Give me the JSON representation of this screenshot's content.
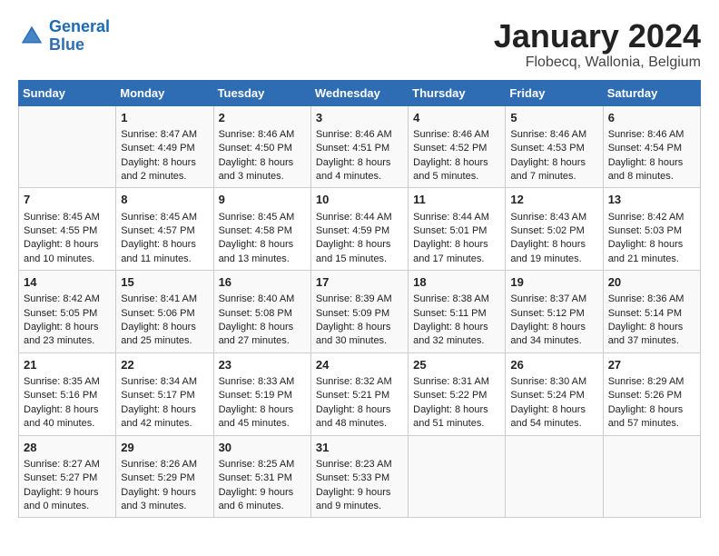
{
  "header": {
    "logo_line1": "General",
    "logo_line2": "Blue",
    "title": "January 2024",
    "subtitle": "Flobecq, Wallonia, Belgium"
  },
  "calendar": {
    "headers": [
      "Sunday",
      "Monday",
      "Tuesday",
      "Wednesday",
      "Thursday",
      "Friday",
      "Saturday"
    ],
    "rows": [
      [
        {
          "day": "",
          "sunrise": "",
          "sunset": "",
          "daylight": ""
        },
        {
          "day": "1",
          "sunrise": "Sunrise: 8:47 AM",
          "sunset": "Sunset: 4:49 PM",
          "daylight": "Daylight: 8 hours and 2 minutes."
        },
        {
          "day": "2",
          "sunrise": "Sunrise: 8:46 AM",
          "sunset": "Sunset: 4:50 PM",
          "daylight": "Daylight: 8 hours and 3 minutes."
        },
        {
          "day": "3",
          "sunrise": "Sunrise: 8:46 AM",
          "sunset": "Sunset: 4:51 PM",
          "daylight": "Daylight: 8 hours and 4 minutes."
        },
        {
          "day": "4",
          "sunrise": "Sunrise: 8:46 AM",
          "sunset": "Sunset: 4:52 PM",
          "daylight": "Daylight: 8 hours and 5 minutes."
        },
        {
          "day": "5",
          "sunrise": "Sunrise: 8:46 AM",
          "sunset": "Sunset: 4:53 PM",
          "daylight": "Daylight: 8 hours and 7 minutes."
        },
        {
          "day": "6",
          "sunrise": "Sunrise: 8:46 AM",
          "sunset": "Sunset: 4:54 PM",
          "daylight": "Daylight: 8 hours and 8 minutes."
        }
      ],
      [
        {
          "day": "7",
          "sunrise": "Sunrise: 8:45 AM",
          "sunset": "Sunset: 4:55 PM",
          "daylight": "Daylight: 8 hours and 10 minutes."
        },
        {
          "day": "8",
          "sunrise": "Sunrise: 8:45 AM",
          "sunset": "Sunset: 4:57 PM",
          "daylight": "Daylight: 8 hours and 11 minutes."
        },
        {
          "day": "9",
          "sunrise": "Sunrise: 8:45 AM",
          "sunset": "Sunset: 4:58 PM",
          "daylight": "Daylight: 8 hours and 13 minutes."
        },
        {
          "day": "10",
          "sunrise": "Sunrise: 8:44 AM",
          "sunset": "Sunset: 4:59 PM",
          "daylight": "Daylight: 8 hours and 15 minutes."
        },
        {
          "day": "11",
          "sunrise": "Sunrise: 8:44 AM",
          "sunset": "Sunset: 5:01 PM",
          "daylight": "Daylight: 8 hours and 17 minutes."
        },
        {
          "day": "12",
          "sunrise": "Sunrise: 8:43 AM",
          "sunset": "Sunset: 5:02 PM",
          "daylight": "Daylight: 8 hours and 19 minutes."
        },
        {
          "day": "13",
          "sunrise": "Sunrise: 8:42 AM",
          "sunset": "Sunset: 5:03 PM",
          "daylight": "Daylight: 8 hours and 21 minutes."
        }
      ],
      [
        {
          "day": "14",
          "sunrise": "Sunrise: 8:42 AM",
          "sunset": "Sunset: 5:05 PM",
          "daylight": "Daylight: 8 hours and 23 minutes."
        },
        {
          "day": "15",
          "sunrise": "Sunrise: 8:41 AM",
          "sunset": "Sunset: 5:06 PM",
          "daylight": "Daylight: 8 hours and 25 minutes."
        },
        {
          "day": "16",
          "sunrise": "Sunrise: 8:40 AM",
          "sunset": "Sunset: 5:08 PM",
          "daylight": "Daylight: 8 hours and 27 minutes."
        },
        {
          "day": "17",
          "sunrise": "Sunrise: 8:39 AM",
          "sunset": "Sunset: 5:09 PM",
          "daylight": "Daylight: 8 hours and 30 minutes."
        },
        {
          "day": "18",
          "sunrise": "Sunrise: 8:38 AM",
          "sunset": "Sunset: 5:11 PM",
          "daylight": "Daylight: 8 hours and 32 minutes."
        },
        {
          "day": "19",
          "sunrise": "Sunrise: 8:37 AM",
          "sunset": "Sunset: 5:12 PM",
          "daylight": "Daylight: 8 hours and 34 minutes."
        },
        {
          "day": "20",
          "sunrise": "Sunrise: 8:36 AM",
          "sunset": "Sunset: 5:14 PM",
          "daylight": "Daylight: 8 hours and 37 minutes."
        }
      ],
      [
        {
          "day": "21",
          "sunrise": "Sunrise: 8:35 AM",
          "sunset": "Sunset: 5:16 PM",
          "daylight": "Daylight: 8 hours and 40 minutes."
        },
        {
          "day": "22",
          "sunrise": "Sunrise: 8:34 AM",
          "sunset": "Sunset: 5:17 PM",
          "daylight": "Daylight: 8 hours and 42 minutes."
        },
        {
          "day": "23",
          "sunrise": "Sunrise: 8:33 AM",
          "sunset": "Sunset: 5:19 PM",
          "daylight": "Daylight: 8 hours and 45 minutes."
        },
        {
          "day": "24",
          "sunrise": "Sunrise: 8:32 AM",
          "sunset": "Sunset: 5:21 PM",
          "daylight": "Daylight: 8 hours and 48 minutes."
        },
        {
          "day": "25",
          "sunrise": "Sunrise: 8:31 AM",
          "sunset": "Sunset: 5:22 PM",
          "daylight": "Daylight: 8 hours and 51 minutes."
        },
        {
          "day": "26",
          "sunrise": "Sunrise: 8:30 AM",
          "sunset": "Sunset: 5:24 PM",
          "daylight": "Daylight: 8 hours and 54 minutes."
        },
        {
          "day": "27",
          "sunrise": "Sunrise: 8:29 AM",
          "sunset": "Sunset: 5:26 PM",
          "daylight": "Daylight: 8 hours and 57 minutes."
        }
      ],
      [
        {
          "day": "28",
          "sunrise": "Sunrise: 8:27 AM",
          "sunset": "Sunset: 5:27 PM",
          "daylight": "Daylight: 9 hours and 0 minutes."
        },
        {
          "day": "29",
          "sunrise": "Sunrise: 8:26 AM",
          "sunset": "Sunset: 5:29 PM",
          "daylight": "Daylight: 9 hours and 3 minutes."
        },
        {
          "day": "30",
          "sunrise": "Sunrise: 8:25 AM",
          "sunset": "Sunset: 5:31 PM",
          "daylight": "Daylight: 9 hours and 6 minutes."
        },
        {
          "day": "31",
          "sunrise": "Sunrise: 8:23 AM",
          "sunset": "Sunset: 5:33 PM",
          "daylight": "Daylight: 9 hours and 9 minutes."
        },
        {
          "day": "",
          "sunrise": "",
          "sunset": "",
          "daylight": ""
        },
        {
          "day": "",
          "sunrise": "",
          "sunset": "",
          "daylight": ""
        },
        {
          "day": "",
          "sunrise": "",
          "sunset": "",
          "daylight": ""
        }
      ]
    ]
  }
}
